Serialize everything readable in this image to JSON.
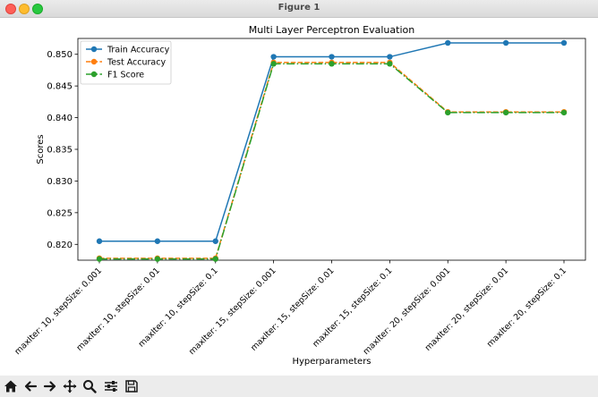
{
  "window": {
    "title": "Figure 1"
  },
  "toolbar": {
    "buttons": [
      {
        "name": "home-icon"
      },
      {
        "name": "back-arrow-icon"
      },
      {
        "name": "forward-arrow-icon"
      },
      {
        "name": "pan-icon"
      },
      {
        "name": "zoom-icon"
      },
      {
        "name": "configure-subplots-icon"
      },
      {
        "name": "save-icon"
      }
    ]
  },
  "chart_data": {
    "type": "line",
    "title": "Multi Layer Perceptron Evaluation",
    "xlabel": "Hyperparameters",
    "ylabel": "Scores",
    "categories": [
      "maxIter: 10, stepSize: 0.001",
      "maxIter: 10, stepSize: 0.01",
      "maxIter: 10, stepSize: 0.1",
      "maxIter: 15, stepSize: 0.001",
      "maxIter: 15, stepSize: 0.01",
      "maxIter: 15, stepSize: 0.1",
      "maxIter: 20, stepSize: 0.001",
      "maxIter: 20, stepSize: 0.01",
      "maxIter: 20, stepSize: 0.1"
    ],
    "ylim": [
      0.8175,
      0.8525
    ],
    "yticks": [
      "0.820",
      "0.825",
      "0.830",
      "0.835",
      "0.840",
      "0.845",
      "0.850"
    ],
    "legend_position": "top-left",
    "series": [
      {
        "name": "Train Accuracy",
        "color": "#1f77b4",
        "linestyle": "solid",
        "values": [
          0.8205,
          0.8205,
          0.8205,
          0.8496,
          0.8496,
          0.8496,
          0.8518,
          0.8518,
          0.8518
        ]
      },
      {
        "name": "Test Accuracy",
        "color": "#ff7f0e",
        "linestyle": "dashed",
        "values": [
          0.8178,
          0.8178,
          0.8178,
          0.8487,
          0.8487,
          0.8487,
          0.8409,
          0.8409,
          0.8409
        ]
      },
      {
        "name": "F1 Score",
        "color": "#2ca02c",
        "linestyle": "dashdot",
        "values": [
          0.8177,
          0.8177,
          0.8177,
          0.8485,
          0.8485,
          0.8485,
          0.8408,
          0.8408,
          0.8408
        ]
      }
    ]
  }
}
